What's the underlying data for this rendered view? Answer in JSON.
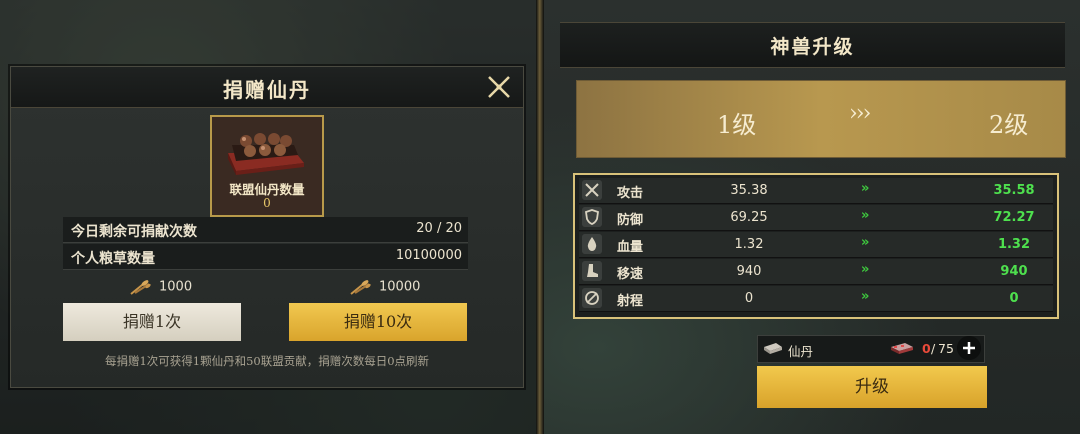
{
  "donate_dialog": {
    "title": "捐赠仙丹",
    "item": {
      "label": "联盟仙丹数量",
      "count": "0"
    },
    "rows": [
      {
        "label": "今日剩余可捐献次数",
        "value": "20 / 20"
      },
      {
        "label": "个人粮草数量",
        "value": "10100000"
      }
    ],
    "costs": {
      "once": "1000",
      "ten": "10000"
    },
    "buttons": {
      "once": "捐赠1次",
      "ten": "捐赠10次"
    },
    "hint": "每捐赠1次可获得1颗仙丹和50联盟贡献，捐赠次数每日0点刷新"
  },
  "upgrade_panel": {
    "title": "神兽升级",
    "from_level": "1级",
    "arrows": "›››",
    "to_level": "2级",
    "stats": [
      {
        "name": "攻击",
        "old": "35.38",
        "arrow": "»",
        "new": "35.58",
        "icon": "crossed-swords-icon"
      },
      {
        "name": "防御",
        "old": "69.25",
        "arrow": "»",
        "new": "72.27",
        "icon": "shield-icon"
      },
      {
        "name": "血量",
        "old": "1.32",
        "arrow": "»",
        "new": "1.32",
        "icon": "blood-drop-icon"
      },
      {
        "name": "移速",
        "old": "940",
        "arrow": "»",
        "new": "940",
        "icon": "boot-icon"
      },
      {
        "name": "射程",
        "old": "0",
        "arrow": "»",
        "new": "0",
        "icon": "range-icon"
      }
    ],
    "requirement": {
      "name": "仙丹",
      "have": "0",
      "sep": "/",
      "need": "75"
    },
    "upgrade_button": "升级"
  },
  "colors": {
    "gold": "#e0b040",
    "green": "#4ee04e",
    "red": "#e94a3a"
  }
}
